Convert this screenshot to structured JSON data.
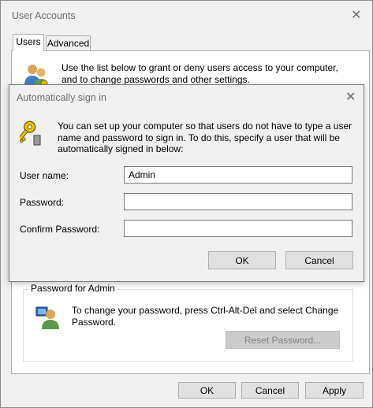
{
  "window": {
    "title": "User Accounts",
    "tabs": [
      "Users",
      "Advanced"
    ],
    "intro": "Use the list below to grant or deny users access to your computer, and to change passwords and other settings.",
    "password_group": {
      "legend": "Password for Admin",
      "text": "To change your password, press Ctrl-Alt-Del and select Change Password.",
      "reset_button": "Reset Password..."
    },
    "buttons": {
      "ok": "OK",
      "cancel": "Cancel",
      "apply": "Apply"
    }
  },
  "dialog": {
    "title": "Automatically sign in",
    "info": "You can set up your computer so that users do not have to type a user name and password to sign in. To do this, specify a user that will be automatically signed in below:",
    "fields": {
      "user_name_label": "User name:",
      "user_name_value": "Admin",
      "password_label": "Password:",
      "password_value": "",
      "confirm_label": "Confirm Password:",
      "confirm_value": ""
    },
    "buttons": {
      "ok": "OK",
      "cancel": "Cancel"
    }
  },
  "icons": {
    "close": "close-icon",
    "users": "users-icon",
    "keys": "keys-icon",
    "user": "user-icon"
  },
  "colors": {
    "window_bg": "#f0f0f0",
    "panel_bg": "#ffffff",
    "button_bg": "#e1e1e1",
    "disabled_text": "#838383"
  }
}
